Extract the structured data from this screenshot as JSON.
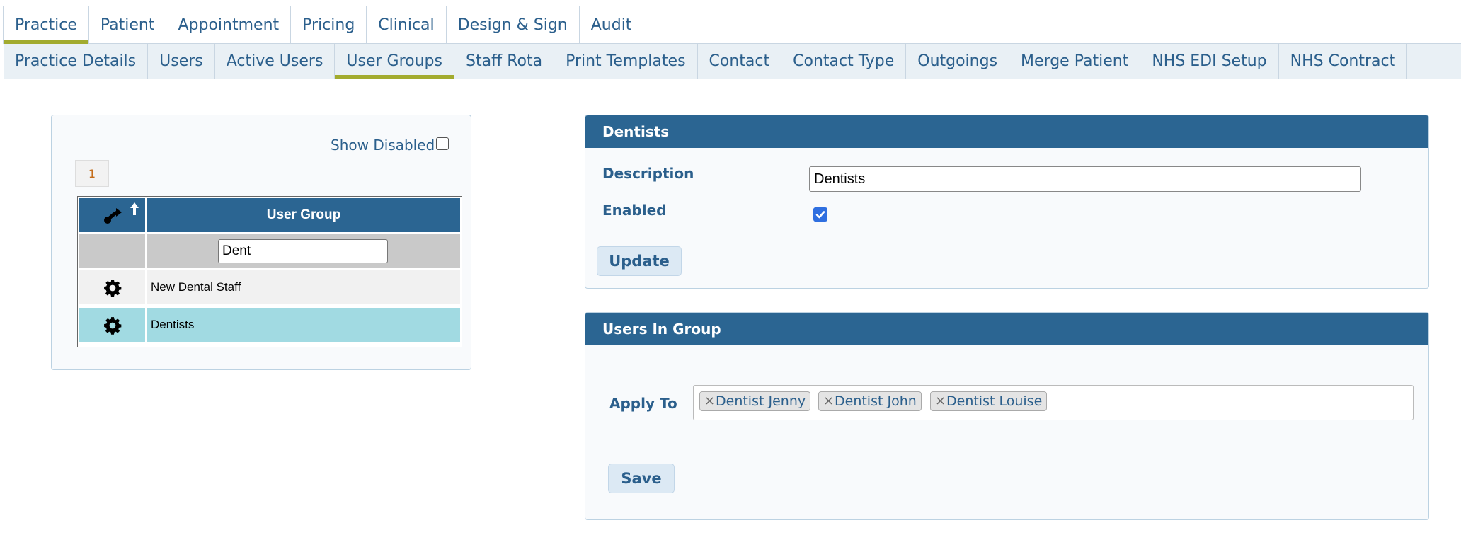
{
  "top_tabs": [
    "Practice",
    "Patient",
    "Appointment",
    "Pricing",
    "Clinical",
    "Design & Sign",
    "Audit"
  ],
  "sub_tabs": [
    "Practice Details",
    "Users",
    "Active Users",
    "User Groups",
    "Staff Rota",
    "Print Templates",
    "Contact",
    "Contact Type",
    "Outgoings",
    "Merge Patient",
    "NHS EDI Setup",
    "NHS Contract"
  ],
  "active_top_tab": "Practice",
  "active_sub_tab": "User Groups",
  "left_panel": {
    "show_disabled_label": "Show Disabled",
    "show_disabled_checked": false,
    "page_number": "1",
    "grid": {
      "column_header": "User Group",
      "filter_value": "Dent",
      "rows": [
        {
          "name": "New Dental Staff",
          "selected": false
        },
        {
          "name": "Dentists",
          "selected": true
        }
      ]
    }
  },
  "details_panel": {
    "title": "Dentists",
    "description_label": "Description",
    "description_value": "Dentists",
    "enabled_label": "Enabled",
    "enabled_checked": true,
    "update_button": "Update"
  },
  "users_panel": {
    "title": "Users In Group",
    "apply_to_label": "Apply To",
    "tags": [
      "Dentist Jenny",
      "Dentist John",
      "Dentist Louise"
    ],
    "save_button": "Save"
  },
  "colors": {
    "header_blue": "#2b6592",
    "text_blue": "#2b5f8c",
    "active_underline": "#a2ab2e",
    "selected_row": "#a1dae2"
  }
}
